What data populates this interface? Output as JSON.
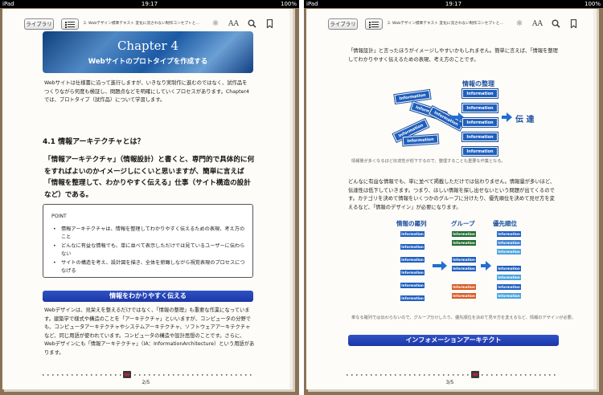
{
  "status": {
    "device": "iPad",
    "time": "19:17",
    "battery": "100%"
  },
  "toolbar": {
    "library_label": "ライブラリ",
    "book_title": "2. Webデザイン標準テキスト 変化に流されない制作コンセプトと…",
    "brightness_icon": "brightness-icon",
    "font_icon_label": "AA",
    "search_icon": "search-icon",
    "bookmark_icon": "bookmark-icon"
  },
  "left_page": {
    "chapter_title": "Chapter 4",
    "chapter_subtitle": "Webサイトのプロトタイプを作成する",
    "intro": "Webサイトは仕様書に沿って進行しますが、いきなり実制作に進むのではなく、試作品をつくりながら何度も検証し、問題点などを明確にしていくプロセスがあります。Chapter4では、プロトタイプ（試作品）について学習します。",
    "section_heading": "4.1 情報アーキテクチャとは？",
    "section_body": "「情報アーキテクチャ」（情報設計）と書くと、専門的で具体的に何をすればよいのかイメージしにくいと思いますが、簡単に言えば「情報を整理して、わかりやすく伝える」仕事（サイト構造の設計など）である。",
    "point_title": "POINT",
    "points": [
      "情報アーキテクチャは、情報を整理してわかりやすく伝えるための表現、考え方のこと",
      "どんなに有益な情報でも、単に並べて表示しただけでは見ているユーザーに伝わらない",
      "サイトの構造を考え、設計図を描き、全体を俯瞰しながら視覚表現のプロセスにつなげる"
    ],
    "bar_label": "情報をわかりやすく伝える",
    "body2": "Webデザインは、見栄えを整えるだけではなく、「情報の整理」も重要な作業になっています。建築学で様式や構造のことを「アーキテクチャ」といいますが、コンピュータの分野でも、コンピュータアーキテクチャやシステムアーキテクチャ、ソフトウェアアーキテクチャなど、同じ用語が使われています。コンピュータの構造や設計思想のことです。さらに、Webデザインにも「情報アーキテクチャ」（IA：InformationArchitecture）という用語があります。",
    "page_number": "2/5"
  },
  "right_page": {
    "top_text": "「情報設計」と言ったほうがイメージしやすいかもしれません。簡単に言えば、「情報を整理してわかりやすく伝えるための表現、考え方のことです。",
    "diagram1": {
      "heading": "情報の整理",
      "block_label": "Information",
      "result": "伝 達",
      "caption": "情報量が多くなるほど伝達性が低下するので、整理することも重要な作業となる。"
    },
    "middle_text": "どんなに有益な情報でも、単に並べて掲載しただけでは伝わりません。情報量が多いほど、伝達性は低下していきます。つまり、ほしい情報を探し出せないという問題が出てくるのです。カテゴリを決めて情報をいくつかのグループに分けたり、優先順位を決めて見せ方を変えるなど、「情報のデザイン」が必要になります。",
    "diagram2": {
      "heading_list": "情報の羅列",
      "heading_group": "グループ",
      "heading_priority": "優先順位",
      "block_label": "Information",
      "caption": "単なる羅列では伝わらないので、グループ分けしたり、優先順位を決めて見せ方を変えるなど、情報のデザインが必要。"
    },
    "bar_label": "インフォメーションアーキテクト",
    "page_number": "3/5"
  },
  "colors": {
    "accent_blue": "#1f5fbd",
    "bar_blue": "#2a49bd",
    "group_green": "#1f6b2e",
    "group_orange": "#d85a24",
    "priority_light": "#4aa3dc"
  }
}
